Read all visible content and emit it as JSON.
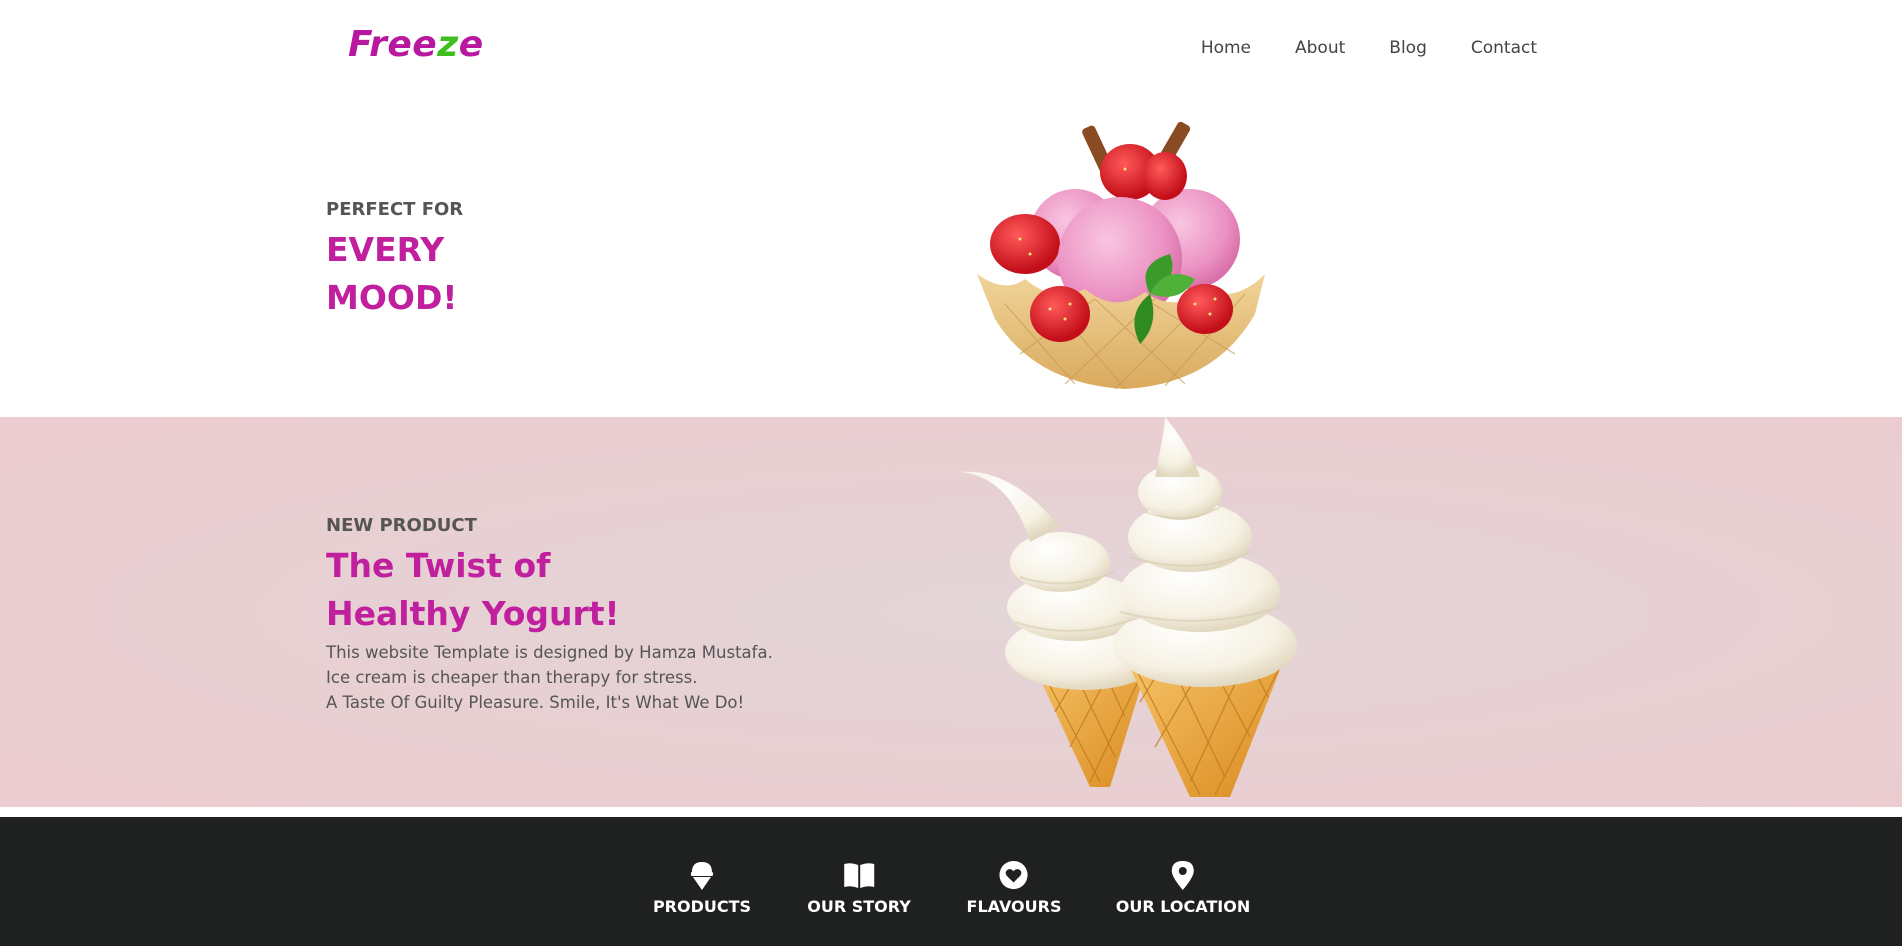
{
  "brand": {
    "logo_part1": "Free",
    "logo_part2": "z",
    "logo_part3": "e"
  },
  "nav": {
    "items": [
      "Home",
      "About",
      "Blog",
      "Contact"
    ]
  },
  "hero1": {
    "eyebrow": "PERFECT FOR",
    "headline_line1": "EVERY",
    "headline_line2": "MOOD!"
  },
  "hero2": {
    "eyebrow": "NEW PRODUCT",
    "headline_line1": "The Twist of",
    "headline_line2": "Healthy Yogurt!",
    "desc": [
      "This website Template is designed by Hamza Mustafa.",
      "Ice cream is cheaper than therapy for stress.",
      "A Taste Of Guilty Pleasure. Smile, It's What We Do!"
    ]
  },
  "footer": {
    "items": [
      {
        "label": "PRODUCTS",
        "icon": "ice-cream-icon"
      },
      {
        "label": "OUR STORY",
        "icon": "book-icon"
      },
      {
        "label": "FLAVOURS",
        "icon": "heart-icon"
      },
      {
        "label": "OUR LOCATION",
        "icon": "map-pin-icon"
      }
    ]
  },
  "colors": {
    "accent": "#c01f9e",
    "logo_green": "#3fbf1f",
    "footer_bg": "#1e2120",
    "band_bg": "#e7d0d3"
  }
}
